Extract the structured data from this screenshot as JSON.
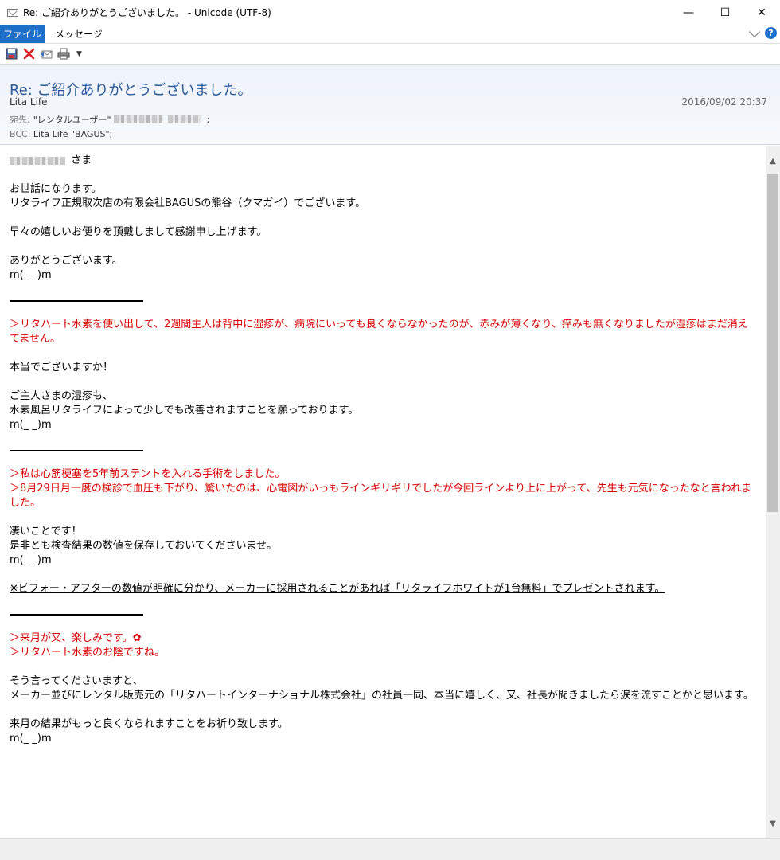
{
  "window": {
    "title": "Re: ご紹介ありがとうございました。 - Unicode (UTF-8)",
    "minimize": "—",
    "maximize": "☐",
    "close": "✕"
  },
  "menu": {
    "file": "ファイル",
    "message": "メッセージ",
    "help": "?"
  },
  "toolbar": {
    "dropdown": "▼"
  },
  "header": {
    "subject": "Re: ご紹介ありがとうございました。",
    "from": "Lita Life",
    "date": "2016/09/02 20:37",
    "to_label": "宛先:",
    "to_value": "\"レンタルユーザー\"",
    "to_suffix": ";",
    "bcc_label": "BCC:",
    "bcc_value": "Lita Life \"BAGUS\";"
  },
  "body": {
    "salutation_suffix": "さま",
    "p1": [
      "お世話になります。",
      "リタライフ正規取次店の有限会社BAGUSの熊谷（クマガイ）でございます。"
    ],
    "p2": "早々の嬉しいお便りを頂戴しまして感謝申し上げます。",
    "p3": "ありがとうございます。",
    "bow": "m(_ _)m",
    "q1": "＞リタハート水素を使い出して、2週間主人は背中に湿疹が、病院にいっても良くならなかったのが、赤みが薄くなり、痒みも無くなりましたが湿疹はまだ消えてません。",
    "r1a": "本当でございますか！",
    "r1b": [
      "ご主人さまの湿疹も、",
      "水素風呂リタライフによって少しでも改善されますことを願っております。"
    ],
    "q2": [
      "＞私は心筋梗塞を5年前ステントを入れる手術をしました。",
      "＞8月29日月一度の検診で血圧も下がり、驚いたのは、心電図がいっもラインギリギリでしたが今回ラインより上に上がって、先生も元気になったなと言われました。"
    ],
    "r2": [
      "凄いことです！",
      "是非とも検査結果の数値を保存しておいてくださいませ。"
    ],
    "note": "※ビフォー・アフターの数値が明確に分かり、メーカーに採用されることがあれば「リタライフホワイトが1台無料」でプレゼントされます。",
    "q3": [
      "＞来月が又、楽しみです。✿",
      "＞リタハート水素のお陰ですね。"
    ],
    "r3": [
      "そう言ってくださいますと、",
      "メーカー並びにレンタル販売元の「リタハートインターナショナル株式会社」の社員一同、本当に嬉しく、又、社長が聞きましたら涙を流すことかと思います。"
    ],
    "r4": "来月の結果がもっと良くなられますことをお祈り致します。"
  },
  "scroll": {
    "up": "▲",
    "down": "▼",
    "position": 0.05
  }
}
